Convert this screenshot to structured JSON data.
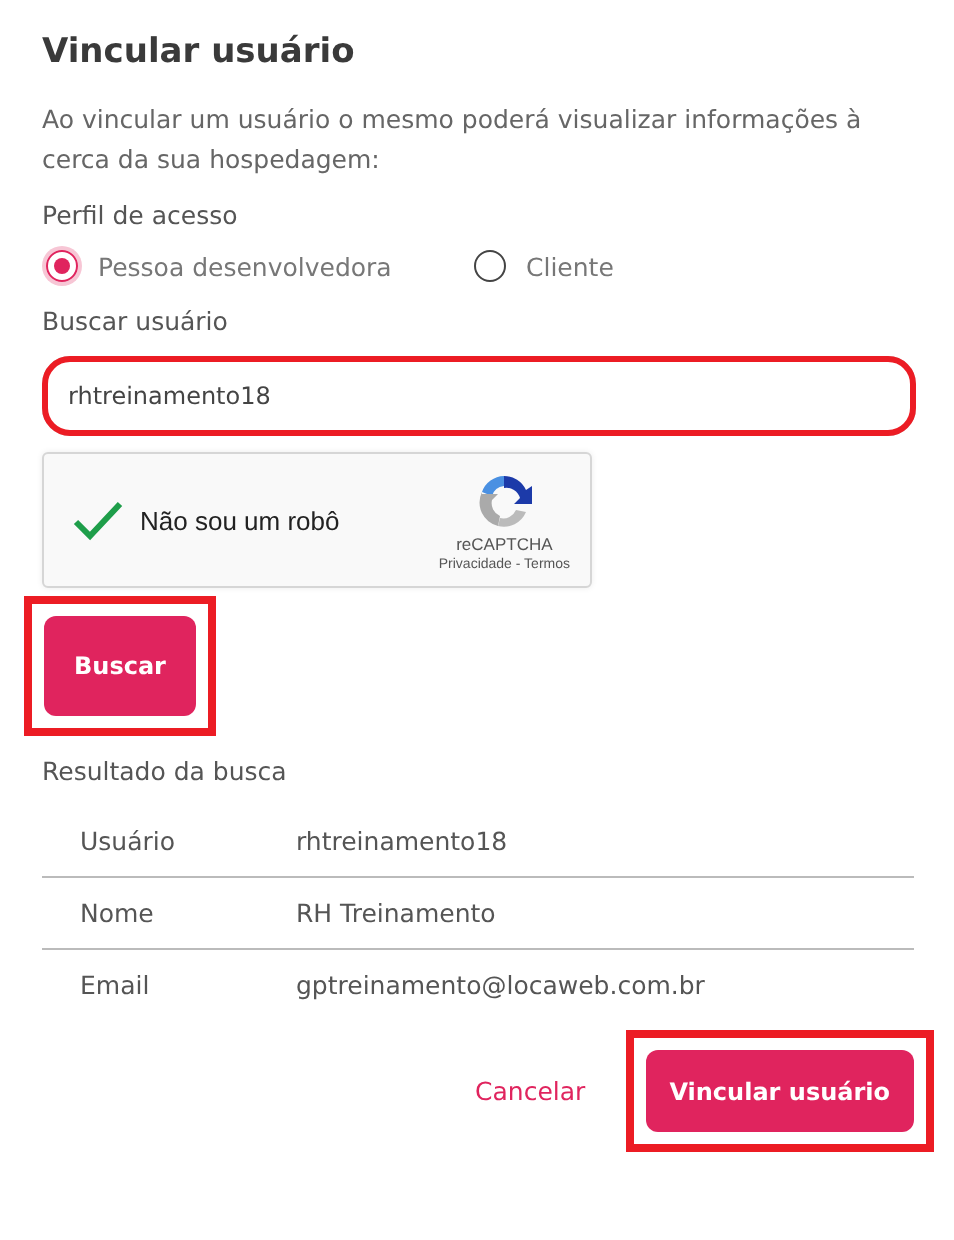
{
  "title": "Vincular usuário",
  "description": "Ao vincular um usuário o mesmo poderá visualizar informações à cerca da sua hospedagem:",
  "access_profile": {
    "label": "Perfil de acesso",
    "options": [
      {
        "label": "Pessoa desenvolvedora",
        "selected": true
      },
      {
        "label": "Cliente",
        "selected": false
      }
    ]
  },
  "search": {
    "label": "Buscar usuário",
    "value": "rhtreinamento18",
    "highlighted": true
  },
  "captcha": {
    "label": "Não sou um robô",
    "checked": true,
    "brand": "reCAPTCHA",
    "links": "Privacidade - Termos"
  },
  "search_button": {
    "label": "Buscar",
    "highlighted": true
  },
  "result": {
    "title": "Resultado da busca",
    "rows": [
      {
        "field": "Usuário",
        "value": "rhtreinamento18"
      },
      {
        "field": "Nome",
        "value": "RH Treinamento"
      },
      {
        "field": "Email",
        "value": "gptreinamento@locaweb.com.br"
      }
    ]
  },
  "actions": {
    "cancel": "Cancelar",
    "confirm": {
      "label": "Vincular usuário",
      "highlighted": true
    }
  }
}
